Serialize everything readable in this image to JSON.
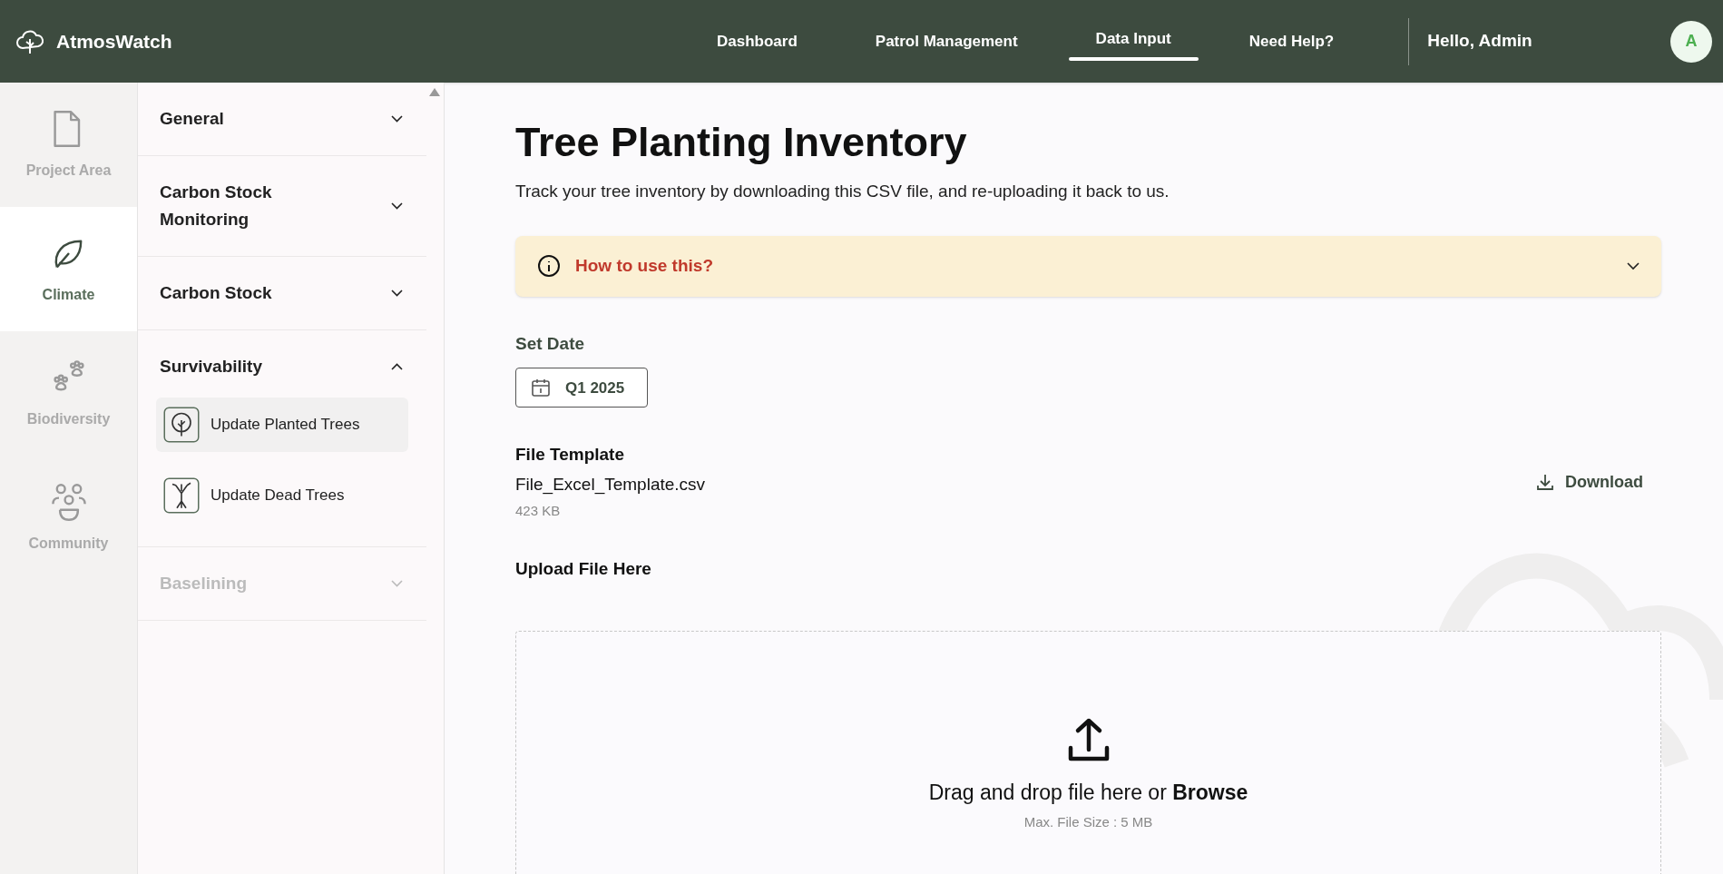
{
  "header": {
    "brand": "AtmosWatch",
    "nav": [
      {
        "label": "Dashboard",
        "selected": false
      },
      {
        "label": "Patrol Management",
        "selected": false
      },
      {
        "label": "Data Input",
        "selected": true
      },
      {
        "label": "Need Help?",
        "selected": false
      }
    ],
    "greeting": "Hello, Admin",
    "avatar": "A"
  },
  "rail": [
    {
      "label": "Project Area",
      "kind": "file",
      "selected": false
    },
    {
      "label": "Climate",
      "kind": "leaf",
      "selected": true
    },
    {
      "label": "Biodiversity",
      "kind": "paw",
      "selected": false
    },
    {
      "label": "Community",
      "kind": "people",
      "selected": false
    }
  ],
  "sections": [
    {
      "title": "General",
      "expanded": false,
      "disabled": false
    },
    {
      "title": "Carbon Stock Monitoring",
      "expanded": false,
      "disabled": false
    },
    {
      "title": "Carbon Stock",
      "expanded": false,
      "disabled": false
    },
    {
      "title": "Survivability",
      "expanded": true,
      "disabled": false,
      "children": [
        {
          "label": "Update Planted Trees",
          "kind": "tree",
          "selected": true
        },
        {
          "label": "Update Dead Trees",
          "kind": "dead-tree",
          "selected": false
        }
      ]
    },
    {
      "title": "Baselining",
      "expanded": false,
      "disabled": true
    }
  ],
  "main": {
    "title": "Tree Planting Inventory",
    "subtitle": "Track your tree inventory by downloading this CSV file, and re-uploading it back to us.",
    "help": {
      "label": "How to use this?",
      "expanded": false
    },
    "date": {
      "label": "Set Date",
      "value": "Q1 2025"
    },
    "template": {
      "label": "File Template",
      "file": "File_Excel_Template.csv",
      "size": "423 KB",
      "action": "Download"
    },
    "upload": {
      "label": "Upload File Here",
      "prompt": "Drag and drop file here or **Browse**",
      "hint": "Max. File Size : 5 MB"
    }
  }
}
